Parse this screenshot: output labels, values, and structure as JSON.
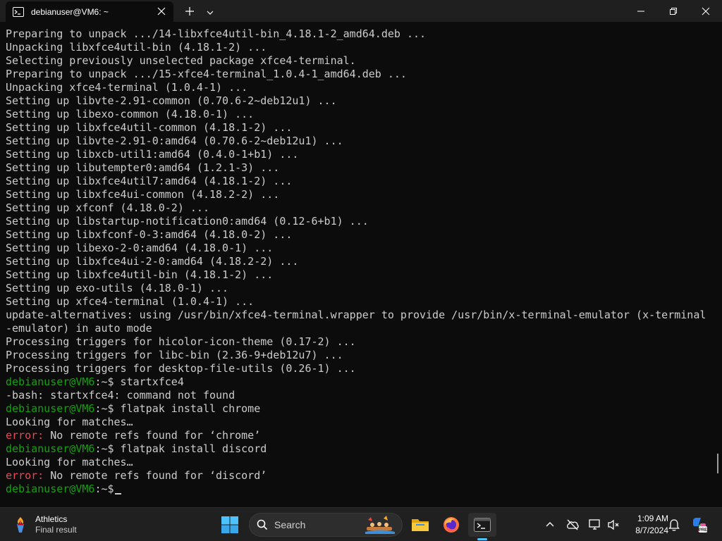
{
  "window": {
    "tab_title": "debianuser@VM6: ~",
    "tab_icon": "terminal-icon",
    "controls": [
      "minimize-icon",
      "maximize-icon",
      "close-icon"
    ]
  },
  "terminal": {
    "lines": [
      [
        {
          "t": "Preparing to unpack .../14-libxfce4util-bin_4.18.1-2_amd64.deb ...",
          "c": ""
        }
      ],
      [
        {
          "t": "Unpacking libxfce4util-bin (4.18.1-2) ...",
          "c": ""
        }
      ],
      [
        {
          "t": "Selecting previously unselected package xfce4-terminal.",
          "c": ""
        }
      ],
      [
        {
          "t": "Preparing to unpack .../15-xfce4-terminal_1.0.4-1_amd64.deb ...",
          "c": ""
        }
      ],
      [
        {
          "t": "Unpacking xfce4-terminal (1.0.4-1) ...",
          "c": ""
        }
      ],
      [
        {
          "t": "Setting up libvte-2.91-common (0.70.6-2~deb12u1) ...",
          "c": ""
        }
      ],
      [
        {
          "t": "Setting up libexo-common (4.18.0-1) ...",
          "c": ""
        }
      ],
      [
        {
          "t": "Setting up libxfce4util-common (4.18.1-2) ...",
          "c": ""
        }
      ],
      [
        {
          "t": "Setting up libvte-2.91-0:amd64 (0.70.6-2~deb12u1) ...",
          "c": ""
        }
      ],
      [
        {
          "t": "Setting up libxcb-util1:amd64 (0.4.0-1+b1) ...",
          "c": ""
        }
      ],
      [
        {
          "t": "Setting up libutempter0:amd64 (1.2.1-3) ...",
          "c": ""
        }
      ],
      [
        {
          "t": "Setting up libxfce4util7:amd64 (4.18.1-2) ...",
          "c": ""
        }
      ],
      [
        {
          "t": "Setting up libxfce4ui-common (4.18.2-2) ...",
          "c": ""
        }
      ],
      [
        {
          "t": "Setting up xfconf (4.18.0-2) ...",
          "c": ""
        }
      ],
      [
        {
          "t": "Setting up libstartup-notification0:amd64 (0.12-6+b1) ...",
          "c": ""
        }
      ],
      [
        {
          "t": "Setting up libxfconf-0-3:amd64 (4.18.0-2) ...",
          "c": ""
        }
      ],
      [
        {
          "t": "Setting up libexo-2-0:amd64 (4.18.0-1) ...",
          "c": ""
        }
      ],
      [
        {
          "t": "Setting up libxfce4ui-2-0:amd64 (4.18.2-2) ...",
          "c": ""
        }
      ],
      [
        {
          "t": "Setting up libxfce4util-bin (4.18.1-2) ...",
          "c": ""
        }
      ],
      [
        {
          "t": "Setting up exo-utils (4.18.0-1) ...",
          "c": ""
        }
      ],
      [
        {
          "t": "Setting up xfce4-terminal (1.0.4-1) ...",
          "c": ""
        }
      ],
      [
        {
          "t": "update-alternatives: using /usr/bin/xfce4-terminal.wrapper to provide /usr/bin/x-terminal-emulator (x-terminal",
          "c": ""
        }
      ],
      [
        {
          "t": "-emulator) in auto mode",
          "c": ""
        }
      ],
      [
        {
          "t": "Processing triggers for hicolor-icon-theme (0.17-2) ...",
          "c": ""
        }
      ],
      [
        {
          "t": "Processing triggers for libc-bin (2.36-9+deb12u7) ...",
          "c": ""
        }
      ],
      [
        {
          "t": "Processing triggers for desktop-file-utils (0.26-1) ...",
          "c": ""
        }
      ],
      [
        {
          "t": "debianuser@VM6",
          "c": "prompt"
        },
        {
          "t": ":~$ startxfce4",
          "c": ""
        }
      ],
      [
        {
          "t": "-bash: startxfce4: command not found",
          "c": ""
        }
      ],
      [
        {
          "t": "debianuser@VM6",
          "c": "prompt"
        },
        {
          "t": ":~$ flatpak install chrome",
          "c": ""
        }
      ],
      [
        {
          "t": "Looking for matches…",
          "c": ""
        }
      ],
      [
        {
          "t": "error:",
          "c": "err"
        },
        {
          "t": " No remote refs found for ‘chrome’",
          "c": ""
        }
      ],
      [
        {
          "t": "debianuser@VM6",
          "c": "prompt"
        },
        {
          "t": ":~$ flatpak install discord",
          "c": ""
        }
      ],
      [
        {
          "t": "Looking for matches…",
          "c": ""
        }
      ],
      [
        {
          "t": "error:",
          "c": "err"
        },
        {
          "t": " No remote refs found for ‘discord’",
          "c": ""
        }
      ],
      [
        {
          "t": "debianuser@VM6",
          "c": "prompt"
        },
        {
          "t": ":~$",
          "c": ""
        }
      ]
    ]
  },
  "taskbar": {
    "widget": {
      "title": "Athletics",
      "subtitle": "Final result",
      "icon": "torch-icon"
    },
    "search_placeholder": "Search",
    "apps": [
      {
        "name": "file-explorer-icon"
      },
      {
        "name": "firefox-icon"
      },
      {
        "name": "terminal-icon",
        "active": true
      }
    ],
    "tray": [
      "chevron-up-icon",
      "cloud-offline-icon",
      "display-icon",
      "speaker-muted-icon"
    ],
    "clock": {
      "time": "1:09 AM",
      "date": "8/7/2024"
    },
    "extra_icons": [
      "notification-bell-icon",
      "copilot-icon"
    ]
  },
  "colors": {
    "terminal_bg": "#0c0c0c",
    "terminal_fg": "#cccccc",
    "prompt": "#13a10e",
    "error": "#e74856",
    "taskbar_bg": "#202020",
    "accent": "#4cc2ff"
  }
}
